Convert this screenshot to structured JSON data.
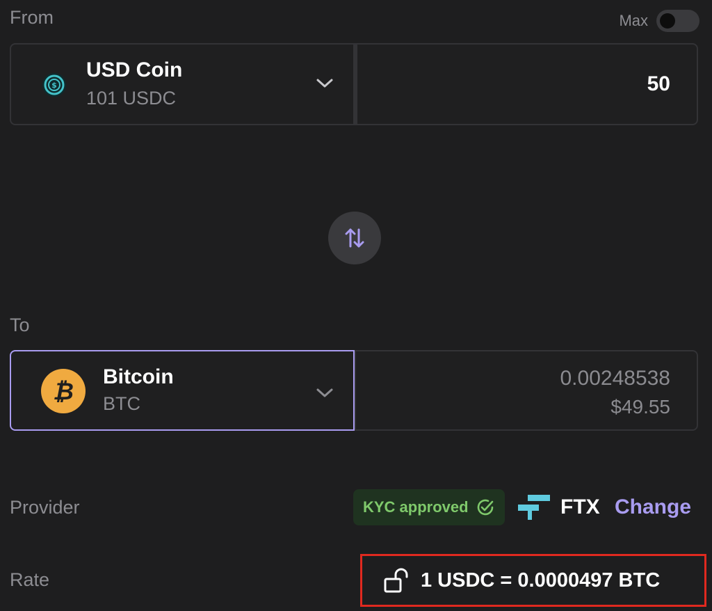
{
  "from": {
    "label": "From",
    "max_label": "Max",
    "asset": {
      "name": "USD Coin",
      "balance": "101 USDC",
      "icon": "usdc-coin-icon"
    },
    "amount": "50"
  },
  "to": {
    "label": "To",
    "asset": {
      "name": "Bitcoin",
      "ticker": "BTC",
      "icon": "bitcoin-icon"
    },
    "amount": "0.00248538",
    "fiat_value": "$49.55"
  },
  "provider": {
    "label": "Provider",
    "kyc_badge": "KYC approved",
    "name": "FTX",
    "change_label": "Change"
  },
  "rate": {
    "label": "Rate",
    "value": "1 USDC = 0.0000497 BTC"
  },
  "colors": {
    "background": "#1e1e1f",
    "accent": "#a99cf0",
    "kyc_green": "#7fc96b",
    "bitcoin_orange": "#f0aa40",
    "usdc_cyan": "#44c2c9",
    "highlight_red": "#e0291f"
  }
}
